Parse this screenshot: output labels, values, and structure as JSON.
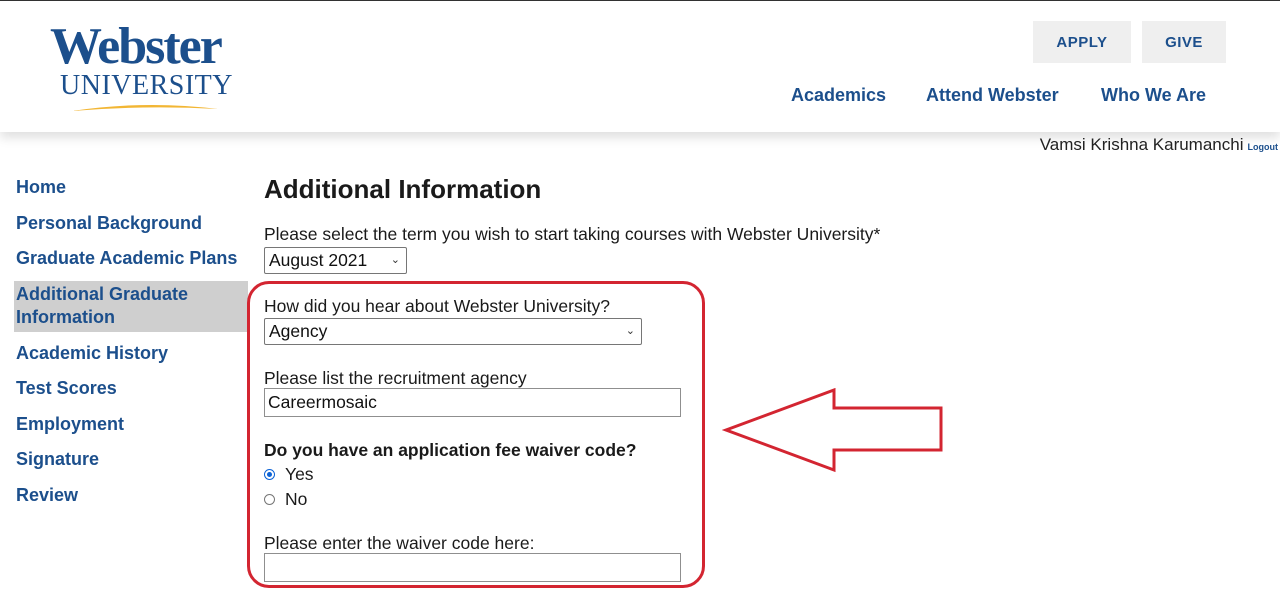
{
  "header": {
    "logo_line1": "Webster",
    "logo_line2": "UNIVERSITY",
    "apply_label": "APPLY",
    "give_label": "GIVE",
    "nav": [
      "Academics",
      "Attend Webster",
      "Who We Are"
    ]
  },
  "user": {
    "name": "Vamsi Krishna Karumanchi",
    "logout_label": "Logout"
  },
  "sidebar": {
    "items": [
      {
        "label": "Home"
      },
      {
        "label": "Personal Background"
      },
      {
        "label": "Graduate Academic Plans"
      },
      {
        "label": "Additional Graduate Information",
        "active": true
      },
      {
        "label": "Academic History"
      },
      {
        "label": "Test Scores"
      },
      {
        "label": "Employment"
      },
      {
        "label": "Signature"
      },
      {
        "label": "Review"
      }
    ]
  },
  "form": {
    "title": "Additional Information",
    "term_label": "Please select the term you wish to start taking courses with Webster University*",
    "term_value": "August 2021",
    "hear_label": "How did you hear about Webster University?",
    "hear_value": "Agency",
    "agency_label": "Please list the recruitment agency",
    "agency_value": "Careermosaic",
    "waiver_question": "Do you have an application fee waiver code?",
    "waiver_yes": "Yes",
    "waiver_no": "No",
    "waiver_selected": "Yes",
    "waiver_code_label": "Please enter the waiver code here:",
    "waiver_code_value": ""
  },
  "colors": {
    "brand_blue": "#1c4f8c",
    "logo_gold": "#f2b634",
    "annotation_red": "#d32531",
    "active_nav_bg": "#cfcfcf",
    "radio_blue": "#0b62d6"
  }
}
